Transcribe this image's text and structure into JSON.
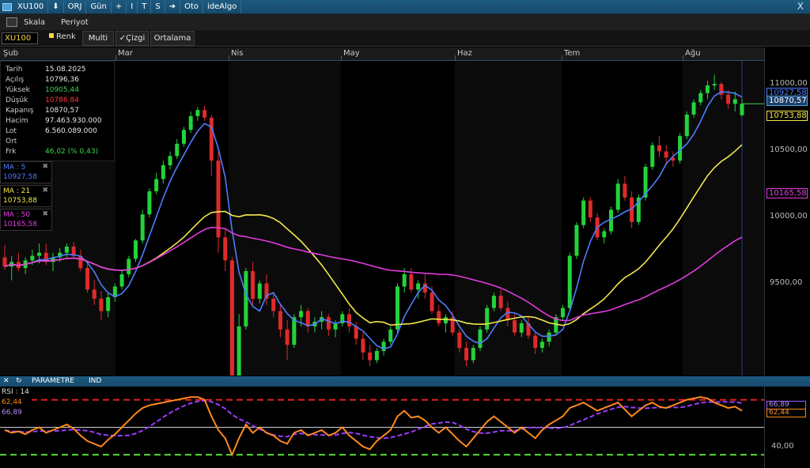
{
  "window": {
    "symbol": "XU100",
    "buttons": [
      "ORJ",
      "Gün",
      "+",
      "I",
      "T",
      "S",
      "Oto",
      "ideAlgo"
    ],
    "close": "X"
  },
  "menu": {
    "items": [
      "Skala",
      "Periyot"
    ]
  },
  "toolbar": {
    "symbol_input": "XU100",
    "renk": "Renk",
    "multi": "Multi",
    "cizgi": "✓Çizgi",
    "ortalama": "Ortalama"
  },
  "months": [
    "Şub",
    "Mar",
    "Nis",
    "May",
    "Haz",
    "Tem",
    "Ağu"
  ],
  "info": [
    {
      "k": "Tarih",
      "v": "15.08.2025",
      "color": "#e8e8e8"
    },
    {
      "k": "Açılış",
      "v": "10796,36",
      "color": "#e8e8e8"
    },
    {
      "k": "Yüksek",
      "v": "10905,44",
      "color": "#3fd34a"
    },
    {
      "k": "Düşük",
      "v": "10786,84",
      "color": "#ff3b3b"
    },
    {
      "k": "Kapanış",
      "v": "10870,57",
      "color": "#e8e8e8"
    },
    {
      "k": "Hacim",
      "v": "97.463.930.000",
      "color": "#e8e8e8"
    },
    {
      "k": "Lot",
      "v": "6.560.089.000",
      "color": "#e8e8e8"
    },
    {
      "k": "Ort",
      "v": "",
      "color": "#e8e8e8"
    },
    {
      "k": "Frk",
      "v": "46,02 (% 0,43)",
      "color": "#3fd34a"
    }
  ],
  "ma": [
    {
      "label": "MA : 5",
      "value": "10927,58",
      "color": "#4f7cff",
      "period": 5
    },
    {
      "label": "MA : 21",
      "value": "10753,88",
      "color": "#f2e84a",
      "period": 21
    },
    {
      "label": "MA : 50",
      "value": "10165,58",
      "color": "#e23ce0",
      "period": 50
    }
  ],
  "yaxis": {
    "labels": [
      "11000,00",
      "10500,00",
      "10000,00",
      "9500,00"
    ]
  },
  "price_tags": [
    {
      "value": "10927,58",
      "color": "#4f7cff",
      "bg": "#000"
    },
    {
      "value": "10870,57",
      "color": "#ffffff",
      "bg": "#1d3f6a"
    },
    {
      "value": "10753,88",
      "color": "#f2e84a",
      "bg": "#000"
    },
    {
      "value": "10165,58",
      "color": "#e23ce0",
      "bg": "#000"
    }
  ],
  "panel": {
    "title": "PARAMETRE",
    "ind": "IND"
  },
  "rsi": {
    "label": "RSI : 14",
    "value1": "62,44",
    "value2": "66,89",
    "axis_label": "40,00",
    "tag1": "66,89",
    "tag2": "62,44",
    "upper": 70,
    "lower": 30,
    "mid": 50
  },
  "chart_data": {
    "type": "candlestick",
    "ylim": [
      9100,
      11150
    ],
    "candles": [
      [
        9870,
        9950,
        9790,
        9810
      ],
      [
        9810,
        9880,
        9720,
        9840
      ],
      [
        9840,
        9900,
        9780,
        9800
      ],
      [
        9800,
        9870,
        9760,
        9850
      ],
      [
        9850,
        9920,
        9820,
        9880
      ],
      [
        9880,
        9960,
        9830,
        9900
      ],
      [
        9900,
        9960,
        9820,
        9840
      ],
      [
        9840,
        9900,
        9780,
        9870
      ],
      [
        9870,
        9930,
        9840,
        9900
      ],
      [
        9900,
        9960,
        9870,
        9940
      ],
      [
        9940,
        9970,
        9860,
        9880
      ],
      [
        9880,
        9920,
        9780,
        9800
      ],
      [
        9800,
        9840,
        9640,
        9660
      ],
      [
        9660,
        9720,
        9560,
        9600
      ],
      [
        9600,
        9650,
        9460,
        9520
      ],
      [
        9520,
        9640,
        9480,
        9610
      ],
      [
        9610,
        9700,
        9580,
        9680
      ],
      [
        9680,
        9790,
        9660,
        9760
      ],
      [
        9760,
        9880,
        9740,
        9860
      ],
      [
        9860,
        9990,
        9840,
        9980
      ],
      [
        9980,
        10180,
        9960,
        10150
      ],
      [
        10150,
        10320,
        10130,
        10300
      ],
      [
        10300,
        10420,
        10280,
        10380
      ],
      [
        10380,
        10500,
        10350,
        10470
      ],
      [
        10470,
        10560,
        10440,
        10530
      ],
      [
        10530,
        10640,
        10510,
        10610
      ],
      [
        10610,
        10720,
        10590,
        10700
      ],
      [
        10700,
        10820,
        10680,
        10790
      ],
      [
        10790,
        10850,
        10760,
        10830
      ],
      [
        10830,
        10860,
        10760,
        10780
      ],
      [
        10780,
        10800,
        10400,
        10500
      ],
      [
        10500,
        10560,
        9900,
        10000
      ],
      [
        10000,
        10050,
        9780,
        9850
      ],
      [
        9850,
        9870,
        8950,
        9100
      ],
      [
        9100,
        9500,
        9000,
        9420
      ],
      [
        9420,
        9800,
        9400,
        9780
      ],
      [
        9780,
        9840,
        9560,
        9600
      ],
      [
        9600,
        9720,
        9570,
        9700
      ],
      [
        9700,
        9760,
        9560,
        9600
      ],
      [
        9600,
        9640,
        9480,
        9520
      ],
      [
        9520,
        9560,
        9350,
        9400
      ],
      [
        9400,
        9460,
        9200,
        9300
      ],
      [
        9300,
        9500,
        9280,
        9480
      ],
      [
        9480,
        9560,
        9420,
        9520
      ],
      [
        9520,
        9540,
        9380,
        9420
      ],
      [
        9420,
        9480,
        9380,
        9450
      ],
      [
        9450,
        9520,
        9400,
        9480
      ],
      [
        9480,
        9500,
        9360,
        9400
      ],
      [
        9400,
        9460,
        9350,
        9440
      ],
      [
        9440,
        9520,
        9420,
        9500
      ],
      [
        9500,
        9540,
        9380,
        9420
      ],
      [
        9420,
        9450,
        9300,
        9340
      ],
      [
        9340,
        9380,
        9200,
        9250
      ],
      [
        9250,
        9300,
        9160,
        9200
      ],
      [
        9200,
        9280,
        9180,
        9260
      ],
      [
        9260,
        9340,
        9230,
        9320
      ],
      [
        9320,
        9420,
        9300,
        9400
      ],
      [
        9400,
        9700,
        9380,
        9680
      ],
      [
        9680,
        9800,
        9640,
        9760
      ],
      [
        9760,
        9800,
        9640,
        9660
      ],
      [
        9660,
        9720,
        9600,
        9700
      ],
      [
        9700,
        9760,
        9600,
        9640
      ],
      [
        9640,
        9680,
        9500,
        9520
      ],
      [
        9520,
        9560,
        9420,
        9440
      ],
      [
        9440,
        9500,
        9380,
        9480
      ],
      [
        9480,
        9520,
        9360,
        9380
      ],
      [
        9380,
        9400,
        9250,
        9280
      ],
      [
        9280,
        9320,
        9160,
        9200
      ],
      [
        9200,
        9300,
        9180,
        9280
      ],
      [
        9280,
        9420,
        9260,
        9400
      ],
      [
        9400,
        9560,
        9380,
        9540
      ],
      [
        9540,
        9640,
        9520,
        9620
      ],
      [
        9620,
        9660,
        9520,
        9540
      ],
      [
        9540,
        9580,
        9420,
        9460
      ],
      [
        9460,
        9500,
        9360,
        9380
      ],
      [
        9380,
        9460,
        9350,
        9440
      ],
      [
        9440,
        9480,
        9340,
        9360
      ],
      [
        9360,
        9380,
        9240,
        9280
      ],
      [
        9280,
        9340,
        9250,
        9320
      ],
      [
        9320,
        9400,
        9290,
        9380
      ],
      [
        9380,
        9500,
        9360,
        9480
      ],
      [
        9480,
        9560,
        9460,
        9540
      ],
      [
        9540,
        9900,
        9520,
        9880
      ],
      [
        9880,
        10100,
        9860,
        10080
      ],
      [
        10080,
        10260,
        10060,
        10240
      ],
      [
        10240,
        10260,
        10100,
        10130
      ],
      [
        10130,
        10160,
        9980,
        10000
      ],
      [
        10000,
        10060,
        9960,
        10040
      ],
      [
        10040,
        10200,
        10020,
        10180
      ],
      [
        10180,
        10380,
        10160,
        10350
      ],
      [
        10350,
        10400,
        10240,
        10260
      ],
      [
        10260,
        10300,
        10060,
        10100
      ],
      [
        10100,
        10280,
        10080,
        10260
      ],
      [
        10260,
        10480,
        10240,
        10460
      ],
      [
        10460,
        10620,
        10440,
        10600
      ],
      [
        10600,
        10660,
        10520,
        10560
      ],
      [
        10560,
        10600,
        10480,
        10520
      ],
      [
        10520,
        10560,
        10460,
        10500
      ],
      [
        10500,
        10680,
        10480,
        10660
      ],
      [
        10660,
        10820,
        10640,
        10800
      ],
      [
        10800,
        10900,
        10780,
        10880
      ],
      [
        10880,
        10960,
        10860,
        10940
      ],
      [
        10940,
        11020,
        10900,
        10990
      ],
      [
        10990,
        11060,
        10960,
        11000
      ],
      [
        11000,
        11010,
        10900,
        10930
      ],
      [
        10930,
        10960,
        10840,
        10870
      ],
      [
        10870,
        10950,
        10820,
        10900
      ],
      [
        10796.36,
        10905.44,
        10786.84,
        10870.57
      ]
    ],
    "rsi_values": [
      48,
      46,
      47,
      45,
      48,
      50,
      46,
      48,
      50,
      52,
      49,
      44,
      40,
      38,
      36,
      41,
      45,
      50,
      55,
      60,
      64,
      66,
      67,
      68,
      69,
      70,
      71,
      72,
      72,
      70,
      58,
      48,
      42,
      30,
      42,
      52,
      46,
      50,
      46,
      44,
      40,
      38,
      46,
      48,
      44,
      46,
      48,
      44,
      46,
      50,
      44,
      40,
      36,
      34,
      40,
      44,
      48,
      58,
      62,
      57,
      58,
      55,
      50,
      46,
      50,
      45,
      40,
      36,
      42,
      48,
      54,
      58,
      54,
      50,
      46,
      50,
      46,
      42,
      48,
      52,
      55,
      58,
      64,
      66,
      68,
      65,
      62,
      64,
      66,
      68,
      63,
      58,
      62,
      66,
      68,
      65,
      64,
      66,
      68,
      70,
      71,
      72,
      71,
      68,
      66,
      64,
      65,
      62
    ]
  }
}
